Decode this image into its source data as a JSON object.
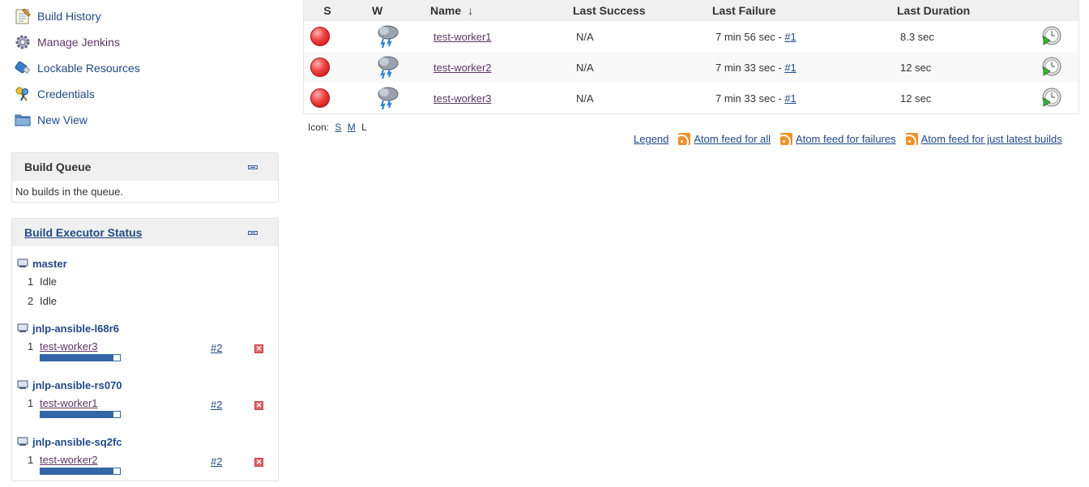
{
  "sidebar": {
    "tasks": [
      {
        "label": "Build History",
        "icon": "notepad-icon"
      },
      {
        "label": "Manage Jenkins",
        "icon": "gear-icon"
      },
      {
        "label": "Lockable Resources",
        "icon": "usb-drive-icon"
      },
      {
        "label": "Credentials",
        "icon": "keys-icon"
      },
      {
        "label": "New View",
        "icon": "folder-icon"
      }
    ]
  },
  "build_queue": {
    "title": "Build Queue",
    "empty_text": "No builds in the queue."
  },
  "executor_status": {
    "title": "Build Executor Status",
    "nodes": [
      {
        "name": "master",
        "executors": [
          {
            "num": "1",
            "state": "Idle"
          },
          {
            "num": "2",
            "state": "Idle"
          }
        ]
      },
      {
        "name": "jnlp-ansible-l68r6",
        "executors": [
          {
            "num": "1",
            "job": "test-worker3",
            "build": "#2",
            "progress": 0.92
          }
        ]
      },
      {
        "name": "jnlp-ansible-rs070",
        "executors": [
          {
            "num": "1",
            "job": "test-worker1",
            "build": "#2",
            "progress": 0.92
          }
        ]
      },
      {
        "name": "jnlp-ansible-sq2fc",
        "executors": [
          {
            "num": "1",
            "job": "test-worker2",
            "build": "#2",
            "progress": 0.92
          }
        ]
      }
    ]
  },
  "projects": {
    "headers": {
      "s": "S",
      "w": "W",
      "name": "Name",
      "sort_arrow": "↓",
      "last_success": "Last Success",
      "last_failure": "Last Failure",
      "last_duration": "Last Duration"
    },
    "rows": [
      {
        "name": "test-worker1",
        "last_success": "N/A",
        "last_failure": "7 min 56 sec - ",
        "failure_build": "#1",
        "last_duration": "8.3 sec",
        "status_color": "#e03030",
        "weather": "thunderstorm"
      },
      {
        "name": "test-worker2",
        "last_success": "N/A",
        "last_failure": "7 min 33 sec - ",
        "failure_build": "#1",
        "last_duration": "12 sec",
        "status_color": "#e03030",
        "weather": "thunderstorm"
      },
      {
        "name": "test-worker3",
        "last_success": "N/A",
        "last_failure": "7 min 33 sec - ",
        "failure_build": "#1",
        "last_duration": "12 sec",
        "status_color": "#e03030",
        "weather": "thunderstorm"
      }
    ]
  },
  "icon_size": {
    "label": "Icon:",
    "options": [
      "S",
      "M",
      "L"
    ],
    "current": "L"
  },
  "footer_links": {
    "legend": "Legend",
    "feed_all": "Atom feed for all",
    "feed_failures": "Atom feed for failures",
    "feed_latest": "Atom feed for just latest builds"
  }
}
